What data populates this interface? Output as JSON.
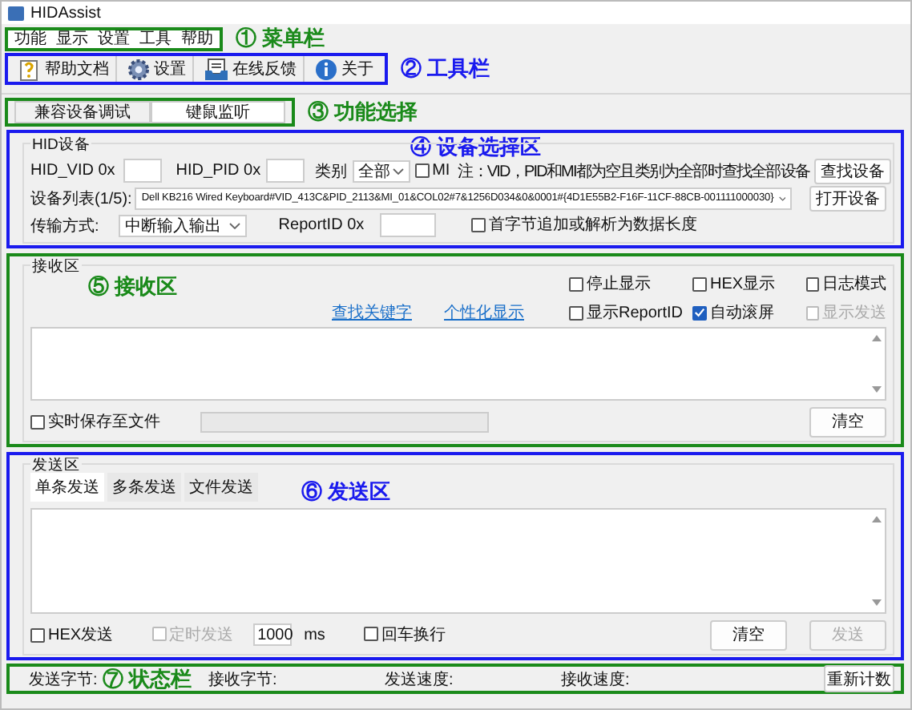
{
  "window": {
    "title": "HIDAssist"
  },
  "menu_bar": {
    "items": [
      "功能",
      "显示",
      "设置",
      "工具",
      "帮助"
    ],
    "annotation": "① 菜单栏"
  },
  "toolbar": {
    "items": [
      {
        "label": "帮助文档",
        "kind": "help"
      },
      {
        "label": "设置",
        "kind": "settings"
      },
      {
        "label": "在线反馈",
        "kind": "feedback"
      },
      {
        "label": "关于",
        "kind": "about"
      }
    ],
    "annotation": "② 工具栏"
  },
  "function_tabs": {
    "tabs": [
      {
        "label": "兼容设备调试",
        "selected": false
      },
      {
        "label": "键鼠监听",
        "selected": true
      }
    ],
    "annotation": "③ 功能选择"
  },
  "device_section": {
    "group_title": "HID设备",
    "annotation": "④ 设备选择区",
    "vid_label": "HID_VID 0x",
    "pid_label": "HID_PID 0x",
    "category_label": "类别",
    "category_value": "全部",
    "mi": {
      "label": "MI",
      "checked": false
    },
    "note": "注：VID，PID和MI都为空且类别为全部时查找全部设备",
    "find_button": "查找设备",
    "device_list_label": "设备列表(1/5):",
    "device_list_value": "Dell KB216 Wired Keyboard#VID_413C&PID_2113&MI_01&COL02#7&1256D034&0&0001#{4D1E55B2-F16F-11CF-88CB-001111000030}",
    "open_button": "打开设备",
    "transfer_label": "传输方式:",
    "transfer_value": "中断输入输出",
    "report_id_label": "ReportID 0x",
    "first_byte": {
      "label": "首字节追加或解析为数据长度",
      "checked": false
    }
  },
  "receive_section": {
    "group_title": "接收区",
    "annotation": "⑤ 接收区",
    "links": [
      "查找关键字",
      "个性化显示"
    ],
    "options": [
      {
        "label": "停止显示",
        "checked": false,
        "disabled": false
      },
      {
        "label": "HEX显示",
        "checked": false,
        "disabled": false
      },
      {
        "label": "日志模式",
        "checked": false,
        "disabled": false
      },
      {
        "label": "显示ReportID",
        "checked": false,
        "disabled": false
      },
      {
        "label": "自动滚屏",
        "checked": true,
        "disabled": false
      },
      {
        "label": "显示发送",
        "checked": false,
        "disabled": true
      }
    ],
    "save_to_file": {
      "label": "实时保存至文件",
      "checked": false
    },
    "clear_button": "清空"
  },
  "send_section": {
    "group_title": "发送区",
    "annotation": "⑥ 发送区",
    "tabs": [
      {
        "label": "单条发送",
        "selected": true
      },
      {
        "label": "多条发送",
        "selected": false
      },
      {
        "label": "文件发送",
        "selected": false
      }
    ],
    "hex_send": {
      "label": "HEX发送",
      "checked": false,
      "disabled": false
    },
    "timed_send": {
      "label": "定时发送",
      "checked": false,
      "disabled": true
    },
    "interval": "1000",
    "interval_unit": "ms",
    "newline": {
      "label": "回车换行",
      "checked": false,
      "disabled": false
    },
    "clear_button": "清空",
    "send_button": {
      "label": "发送",
      "disabled": true
    }
  },
  "status_bar": {
    "items": [
      "发送字节:",
      "接收字节:",
      "发送速度:",
      "接收速度:"
    ],
    "annotation": "⑦ 状态栏",
    "reset_button": "重新计数"
  }
}
